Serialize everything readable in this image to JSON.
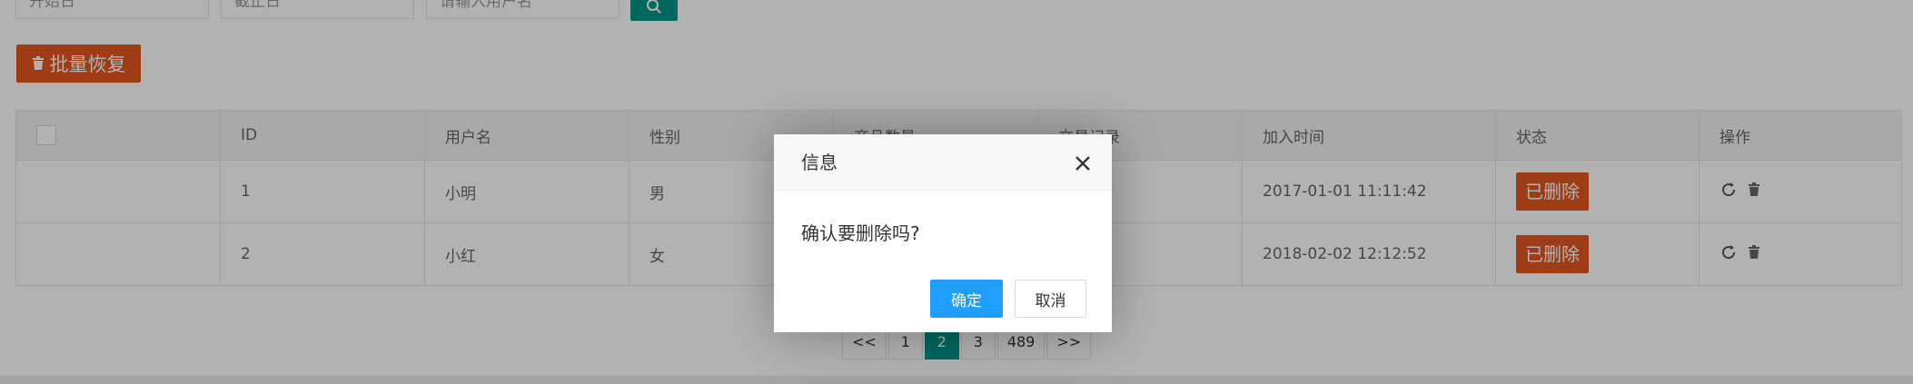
{
  "search": {
    "start_placeholder": "开始日",
    "end_placeholder": "截止日",
    "username_placeholder": "请输入用户名"
  },
  "toolbar": {
    "batch_restore_label": "批量恢复"
  },
  "table": {
    "headers": [
      "",
      "ID",
      "用户名",
      "性别",
      "商品数量",
      "交易记录",
      "加入时间",
      "状态",
      "操作"
    ],
    "rows": [
      {
        "id": "1",
        "username": "小明",
        "gender": "男",
        "joined": "2017-01-01 11:11:42",
        "status": "已删除"
      },
      {
        "id": "2",
        "username": "小红",
        "gender": "女",
        "joined": "2018-02-02 12:12:52",
        "status": "已删除"
      }
    ]
  },
  "pagination": {
    "prev": "<<",
    "pages": [
      "1",
      "2",
      "3",
      "489"
    ],
    "next": ">>",
    "current": "2"
  },
  "dialog": {
    "title": "信息",
    "message": "确认要删除吗?",
    "ok_label": "确定",
    "cancel_label": "取消"
  },
  "colors": {
    "primary": "#009688",
    "danger": "#e2571f",
    "dialog_ok": "#1e9fff"
  }
}
